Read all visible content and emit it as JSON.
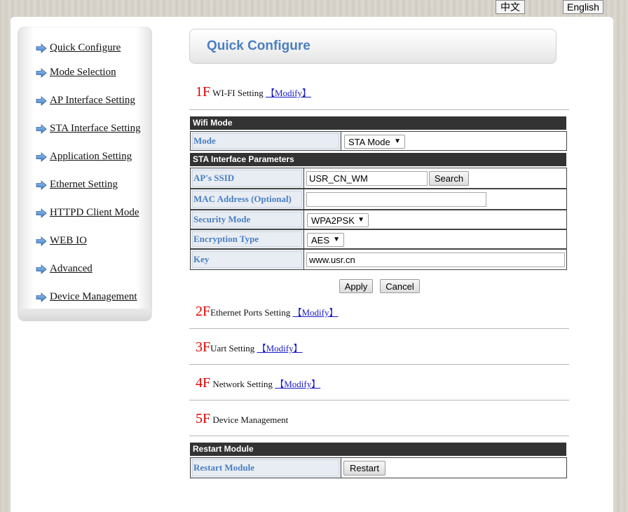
{
  "lang": {
    "chinese": "中文",
    "english": "English"
  },
  "sidebar": {
    "items": [
      {
        "label": "Quick Configure"
      },
      {
        "label": "Mode Selection"
      },
      {
        "label": "AP Interface Setting"
      },
      {
        "label": "STA Interface Setting"
      },
      {
        "label": "Application Setting"
      },
      {
        "label": "Ethernet Setting"
      },
      {
        "label": "HTTPD Client Mode"
      },
      {
        "label": "WEB IO"
      },
      {
        "label": "Advanced"
      },
      {
        "label": "Device Management"
      }
    ]
  },
  "main": {
    "title": "Quick Configure",
    "modify_label": "【Modify】",
    "sections": [
      {
        "num": "1F",
        "label": "WI-FI Setting"
      },
      {
        "num": "2F",
        "label": "Ethernet Ports Setting"
      },
      {
        "num": "3F",
        "label": "Uart Setting"
      },
      {
        "num": "4F",
        "label": "Network Setting"
      },
      {
        "num": "5F",
        "label": "Device Management"
      }
    ],
    "wifi_mode": {
      "header": "Wifi Mode",
      "mode_label": "Mode",
      "mode_value": "STA Mode"
    },
    "sta": {
      "header": "STA Interface Parameters",
      "ssid_label": "AP's SSID",
      "ssid_value": "USR_CN_WM",
      "search_label": "Search",
      "mac_label": "MAC Address (Optional)",
      "mac_value": "",
      "security_label": "Security Mode",
      "security_value": "WPA2PSK",
      "encryption_label": "Encryption Type",
      "encryption_value": "AES",
      "key_label": "Key",
      "key_value": "www.usr.cn"
    },
    "actions": {
      "apply": "Apply",
      "cancel": "Cancel"
    },
    "restart": {
      "header": "Restart Module",
      "label": "Restart Module",
      "button": "Restart"
    }
  },
  "colors": {
    "accent": "#4a7fc1",
    "section_num": "#e00000",
    "link": "#1a1ac8",
    "header_bg": "#333333"
  },
  "icons": {
    "nav": "right-arrow-icon",
    "select": "caret-down-icon"
  }
}
